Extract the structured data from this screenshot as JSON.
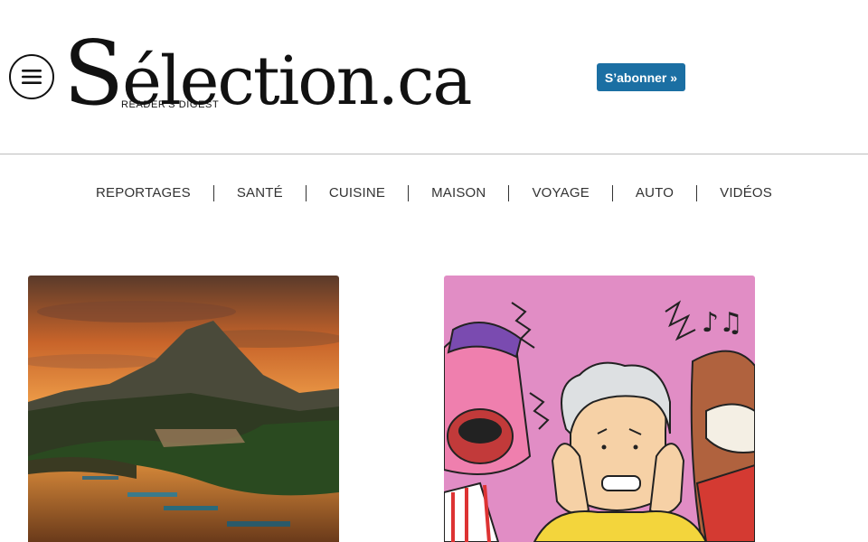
{
  "header": {
    "logo": {
      "main": "Sélection.ca",
      "first_letter": "S",
      "rest": "élection.ca",
      "sub": "READER'S DIGEST"
    },
    "subscribe_label": "S’abonner »",
    "menu_icon": "hamburger-menu-icon"
  },
  "nav": {
    "items": [
      "REPORTAGES",
      "SANTÉ",
      "CUISINE",
      "MAISON",
      "VOYAGE",
      "AUTO",
      "VIDÉOS"
    ]
  },
  "articles": [
    {
      "image": "river-mountain-sunset-photo"
    },
    {
      "image": "noisy-neighbors-illustration"
    }
  ],
  "colors": {
    "accent": "#1b6fa3",
    "text": "#222222",
    "divider": "#bdbdbd",
    "illustration_bg": "#e18dc5"
  }
}
